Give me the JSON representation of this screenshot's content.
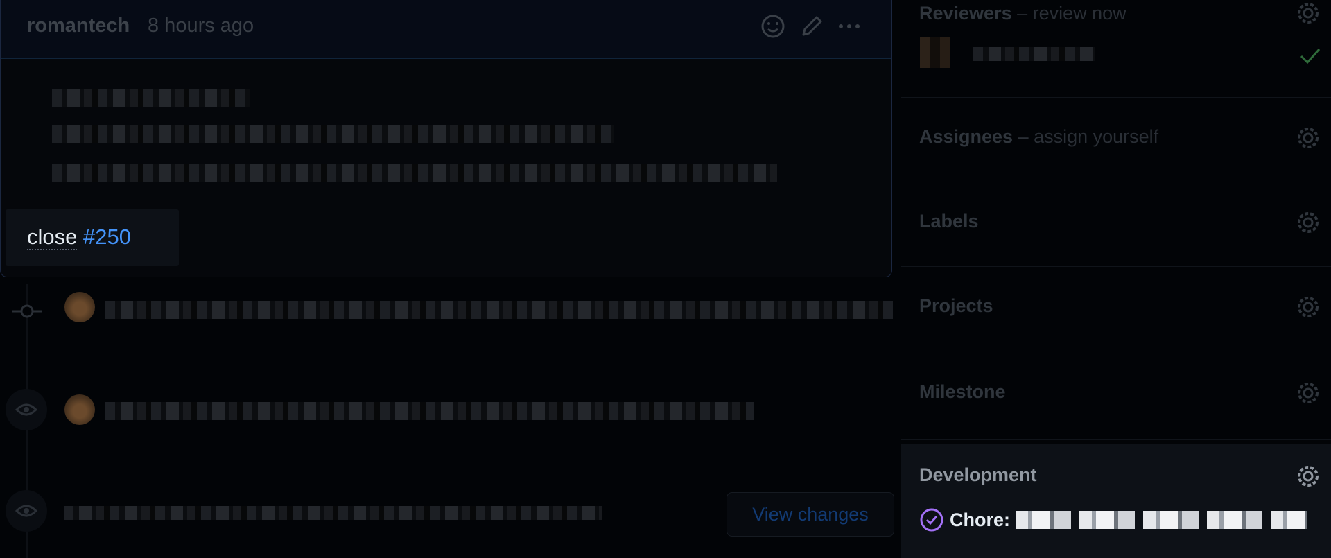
{
  "comment": {
    "author": "romantech",
    "time": "8 hours ago",
    "popover": {
      "word": "close",
      "ref": "#250"
    }
  },
  "view_changes_label": "View changes",
  "sidebar": {
    "reviewers": {
      "title": "Reviewers",
      "sub": " – review now"
    },
    "assignees": {
      "title": "Assignees",
      "sub": " – assign yourself"
    },
    "labels": {
      "title": "Labels"
    },
    "projects": {
      "title": "Projects"
    },
    "milestone": {
      "title": "Milestone"
    },
    "development": {
      "title": "Development",
      "item_prefix": "Chore:"
    }
  },
  "colors": {
    "link": "#4493f8",
    "check": "#2f6b3a",
    "dev_icon": "#a371f7"
  },
  "icons": [
    "smiley-icon",
    "pencil-icon",
    "kebab-icon",
    "commit-icon",
    "eye-icon",
    "gear-icon",
    "check-icon",
    "pr-merged-icon"
  ]
}
